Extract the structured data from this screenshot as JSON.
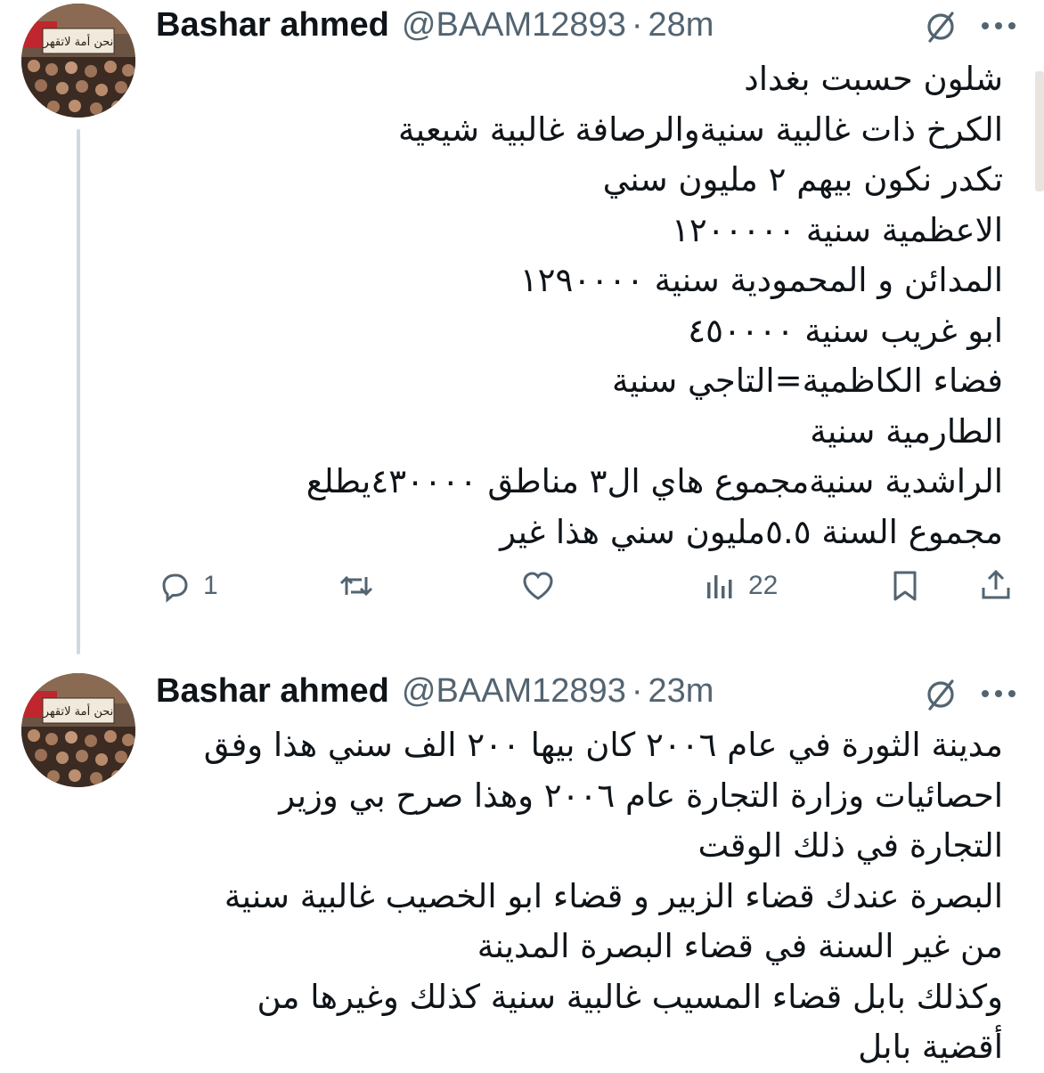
{
  "tweets": [
    {
      "author": {
        "name": "Bashar ahmed",
        "handle": "@BAAM12893",
        "time": "28m",
        "avatar": "avatar-protest-banner"
      },
      "lines": [
        "شلون حسبت بغداد",
        "الكرخ ذات غالبية سنيةوالرصافة غالبية شيعية",
        "تكدر نكون بيهم ٢ مليون سني",
        "الاعظمية سنية ١٢٠٠٠٠٠",
        "المدائن و المحمودية سنية ١٢٩٠٠٠٠",
        "ابو غريب سنية ٤٥٠٠٠٠",
        "فضاء الكاظمية=التاجي سنية",
        "الطارمية سنية",
        "الراشدية سنيةمجموع هاي ال٣ مناطق ٤٣٠٠٠٠يطلع",
        "مجموع السنة ٥.٥مليون سني هذا غير"
      ],
      "actions": {
        "reply_count": "1",
        "repost_count": "",
        "like_count": "",
        "views_count": "22"
      }
    },
    {
      "author": {
        "name": "Bashar ahmed",
        "handle": "@BAAM12893",
        "time": "23m",
        "avatar": "avatar-protest-banner"
      },
      "lines": [
        "مدينة الثورة في عام ٢٠٠٦ كان بيها ٢٠٠ الف سني هذا وفق",
        "احصائيات وزارة التجارة عام ٢٠٠٦ وهذا صرح بي وزير",
        "التجارة في ذلك الوقت",
        "البصرة عندك قضاء الزبير و قضاء ابو الخصيب غالبية سنية",
        "من غير السنة في قضاء البصرة المدينة",
        "وكذلك بابل قضاء المسيب غالبية سنية كذلك وغيرها من",
        "أقضية بابل"
      ]
    }
  ],
  "separator": "·",
  "avatar_banner_text": "نحن أمة لاتقهر",
  "icons": [
    "grok-icon",
    "more-icon",
    "reply-icon",
    "repost-icon",
    "like-icon",
    "views-icon",
    "bookmark-icon",
    "share-icon"
  ]
}
